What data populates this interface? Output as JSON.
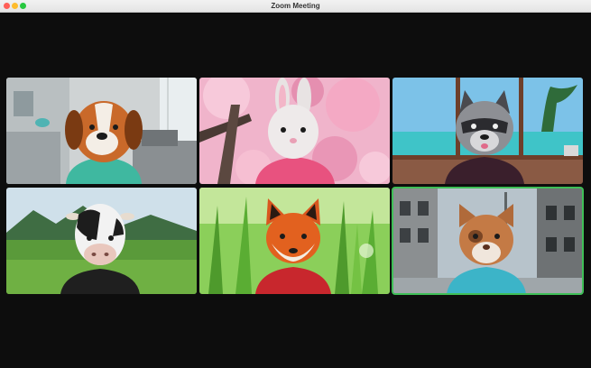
{
  "window": {
    "title": "Zoom Meeting",
    "traffic_lights": {
      "close": "#ff5f57",
      "minimize": "#febc2e",
      "maximize": "#28c840"
    }
  },
  "gallery": {
    "active_speaker_color": "#3fbf57",
    "tiles": [
      {
        "id": "dog",
        "avatar": "dog-avatar",
        "background": "living-room"
      },
      {
        "id": "bunny",
        "avatar": "bunny-avatar",
        "background": "cherry-blossom"
      },
      {
        "id": "raccoon",
        "avatar": "raccoon-avatar",
        "background": "beach-window"
      },
      {
        "id": "cow",
        "avatar": "cow-avatar",
        "background": "green-valley"
      },
      {
        "id": "fox",
        "avatar": "fox-avatar",
        "background": "tall-grass"
      },
      {
        "id": "cat",
        "avatar": "cat-avatar",
        "background": "city-street",
        "active_speaker": true
      }
    ]
  }
}
